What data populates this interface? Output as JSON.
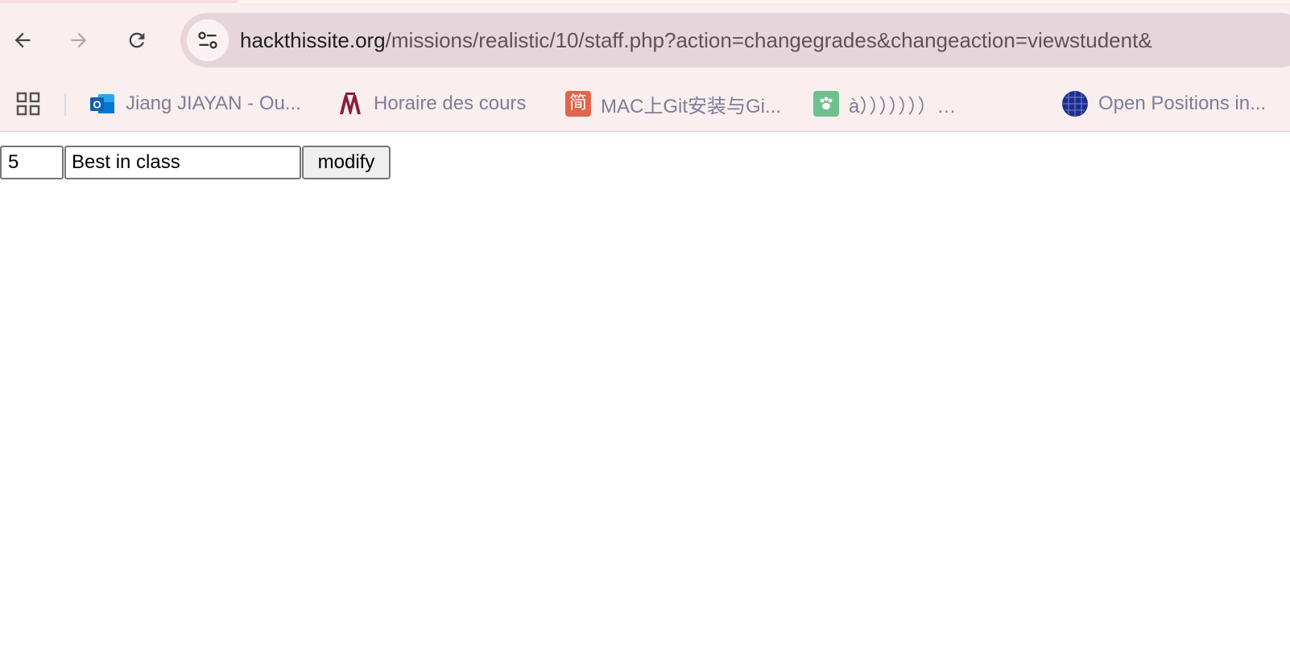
{
  "browser": {
    "url_host": "hackthissite.org",
    "url_path": "/missions/realistic/10/staff.php?action=changegrades&changeaction=viewstudent&",
    "nav": {
      "back_icon": "back-arrow-icon",
      "forward_icon": "forward-arrow-icon",
      "reload_icon": "reload-icon"
    },
    "site_info_icon": "tune-icon",
    "bookmarks": [
      {
        "label": "Jiang JIAYAN - Ou...",
        "icon": "outlook-icon",
        "color": "#1a73c8"
      },
      {
        "label": "Horaire des cours",
        "icon": "university-logo-icon",
        "color": "#8c1d3a"
      },
      {
        "label": "MAC上Git安装与Gi...",
        "icon": "jianshu-icon",
        "color": "#e0664d",
        "icon_text": "简"
      },
      {
        "label": "à）））））））…",
        "icon": "paw-icon",
        "color": "#6fc08f"
      },
      {
        "label": "Open Positions in...",
        "icon": "globe-grid-icon",
        "color": "#1e2f8a"
      }
    ]
  },
  "page": {
    "grade_value": "5",
    "comment_value": "Best in class",
    "modify_label": "modify"
  }
}
